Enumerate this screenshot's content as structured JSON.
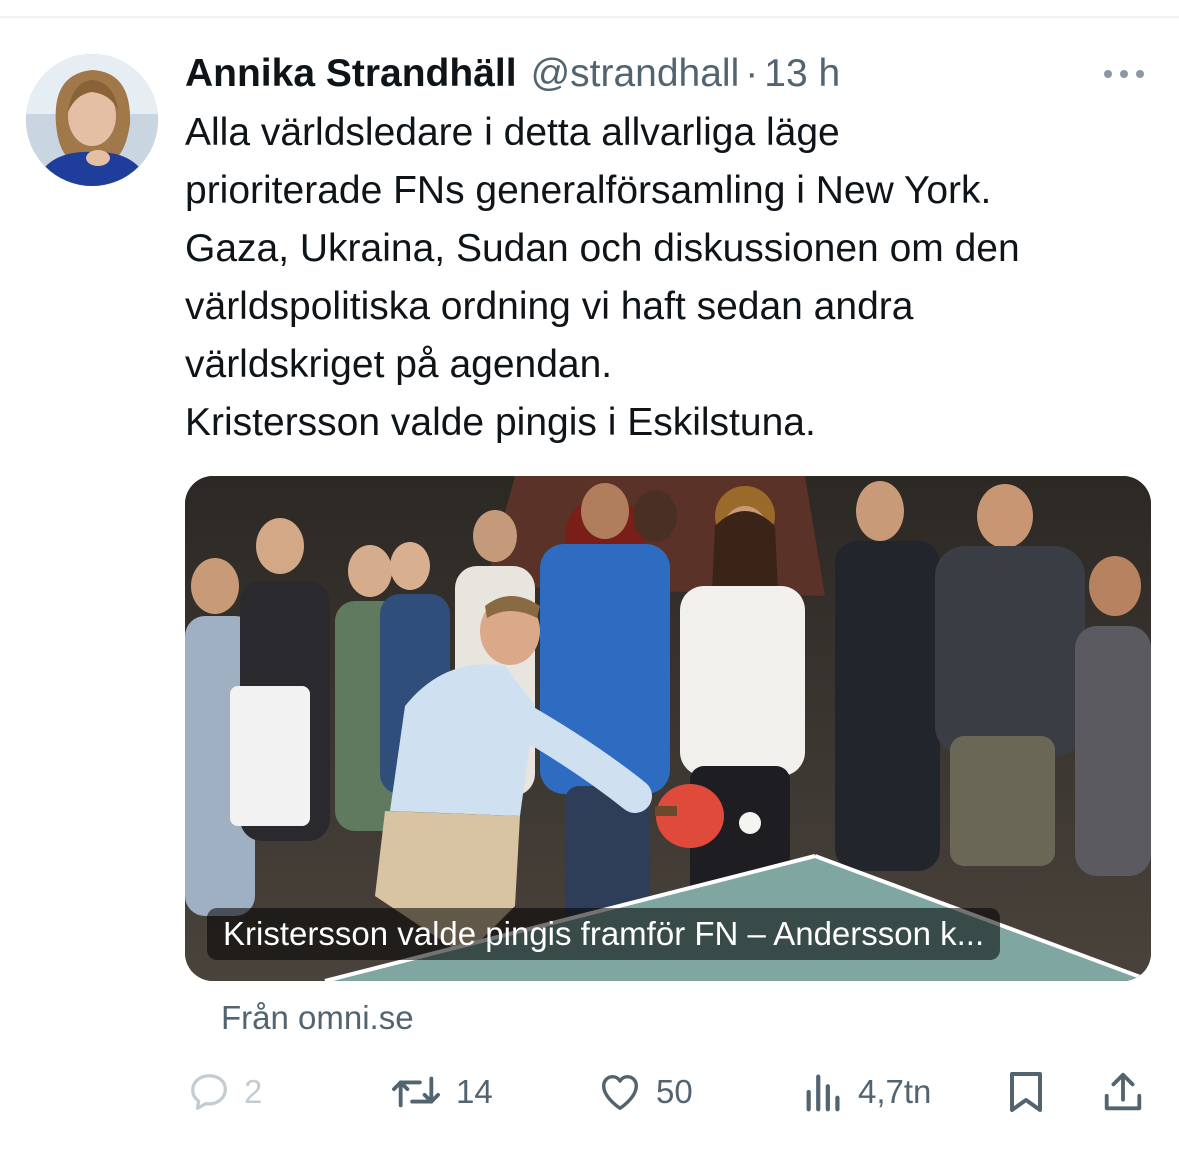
{
  "tweet": {
    "author_name": "Annika Strandhäll",
    "handle": "@strandhall",
    "separator": "·",
    "time": "13 h",
    "text_lines": [
      "Alla världsledare i detta allvarliga läge",
      "prioriterade FNs generalförsamling i New York.",
      "Gaza, Ukraina, Sudan och diskussionen om den",
      "världspolitiska ordning vi haft sedan andra",
      "världskriget på agendan.",
      "Kristersson valde pingis i Eskilstuna."
    ]
  },
  "card": {
    "caption": "Kristersson valde pingis framför FN – Andersson k...",
    "source": "Från omni.se"
  },
  "actions": {
    "replies": "2",
    "retweets": "14",
    "likes": "50",
    "views": "4,7tn"
  },
  "icons": {
    "more": "more-dots-icon",
    "reply": "reply-bubble-icon",
    "retweet": "retweet-icon",
    "like": "heart-icon",
    "views": "bar-chart-icon",
    "bookmark": "bookmark-icon",
    "share": "share-upload-icon"
  },
  "colors": {
    "text": "#0f1419",
    "secondary": "#536471",
    "faded": "#c4ccd2",
    "icon": "#536471"
  }
}
